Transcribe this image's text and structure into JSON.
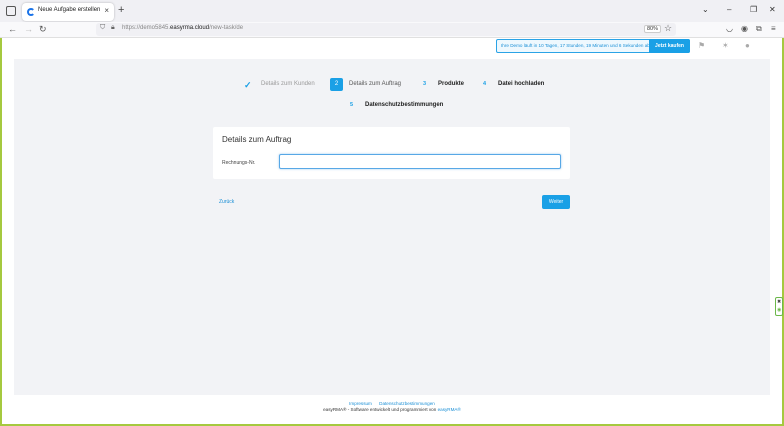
{
  "browser": {
    "tab_title": "Neue Aufgabe erstellen",
    "tab_close": "×",
    "new_tab": "+",
    "url_prefix": "https://demo5845.",
    "url_domain": "easyrma.cloud",
    "url_path": "/new-task/de",
    "zoom": "80%",
    "win_minimize": "⌄",
    "win_min": "–",
    "win_restore": "❐",
    "win_close": "✕"
  },
  "header": {
    "trial_text": "Ihre Demo läuft in 10 Tagen, 17 Stunden, 19 Minuten und 6 Sekunden ab",
    "buy_label": "Jetzt kaufen"
  },
  "steps": [
    {
      "number": "✓",
      "label": "Details zum Kunden"
    },
    {
      "number": "2",
      "label": "Details zum Auftrag"
    },
    {
      "number": "3",
      "label": "Produkte"
    },
    {
      "number": "4",
      "label": "Datei hochladen"
    },
    {
      "number": "5",
      "label": "Datenschutzbestimmungen"
    }
  ],
  "card": {
    "title": "Details zum Auftrag",
    "field_label": "Rechnungs-Nr.",
    "field_value": ""
  },
  "actions": {
    "back_label": "Zurück",
    "next_label": "Weiter"
  },
  "footer": {
    "imprint": "Impressum",
    "privacy": "Datenschutzbestimmungen",
    "copy_prefix": "easyRMA® - Software entwickelt und programmiert von",
    "copy_brand": "easyRMA®"
  },
  "colors": {
    "accent": "#1aa0e6",
    "frame": "#a5c93f"
  }
}
